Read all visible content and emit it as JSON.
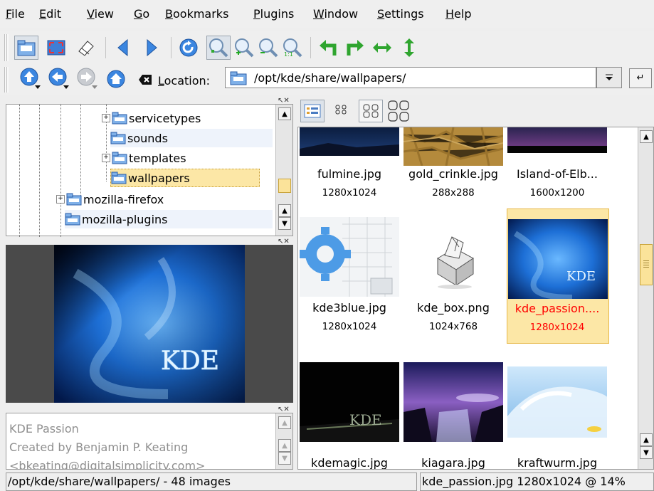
{
  "menubar": {
    "items": [
      {
        "pre": "",
        "u": "F",
        "post": "ile"
      },
      {
        "pre": "",
        "u": "E",
        "post": "dit"
      },
      {
        "pre": "",
        "u": "V",
        "post": "iew"
      },
      {
        "pre": "",
        "u": "G",
        "post": "o"
      },
      {
        "pre": "",
        "u": "B",
        "post": "ookmarks"
      },
      {
        "pre": "",
        "u": "P",
        "post": "lugins"
      },
      {
        "pre": "",
        "u": "W",
        "post": "indow"
      },
      {
        "pre": "",
        "u": "S",
        "post": "ettings"
      },
      {
        "pre": "",
        "u": "H",
        "post": "elp"
      }
    ]
  },
  "location": {
    "label_pre": "L",
    "label_post": "ocation:",
    "path": "/opt/kde/share/wallpapers/"
  },
  "tree": {
    "items": [
      {
        "label": "servicetypes",
        "expander": "+"
      },
      {
        "label": "sounds",
        "expander": ""
      },
      {
        "label": "templates",
        "expander": "+"
      },
      {
        "label": "wallpapers",
        "expander": ""
      },
      {
        "label": "mozilla-firefox",
        "expander": "+"
      },
      {
        "label": "mozilla-plugins",
        "expander": ""
      }
    ]
  },
  "preview": {
    "watermark": "KDE"
  },
  "info": {
    "lines": [
      "KDE Passion",
      "Created by Benjamin P. Keating",
      "<bkeating@digitalsimplicity.com>"
    ]
  },
  "thumbnails": [
    {
      "name": "fulmine.jpg",
      "size": "1280x1024"
    },
    {
      "name": "gold_crinkle.jpg",
      "size": "288x288"
    },
    {
      "name": "Island-of-Elb...",
      "size": "1600x1200"
    },
    {
      "name": "kde3blue.jpg",
      "size": "1280x1024"
    },
    {
      "name": "kde_box.png",
      "size": "1024x768"
    },
    {
      "name": "kde_passion....",
      "size": "1280x1024",
      "selected": true
    },
    {
      "name": "kdemagic.jpg",
      "size": ""
    },
    {
      "name": "kiagara.jpg",
      "size": ""
    },
    {
      "name": "kraftwurm.jpg",
      "size": ""
    }
  ],
  "thumb_art": {
    "kdemagic": "KDE"
  },
  "status": {
    "left": "/opt/kde/share/wallpapers/ - 48 images",
    "right": "kde_passion.jpg 1280x1024 @ 14%"
  },
  "colors": {
    "selection_bg": "#fce7a6",
    "selection_border": "#e7b84b",
    "selected_text": "#ff0000",
    "folder_blue": "#3d7fd1"
  }
}
